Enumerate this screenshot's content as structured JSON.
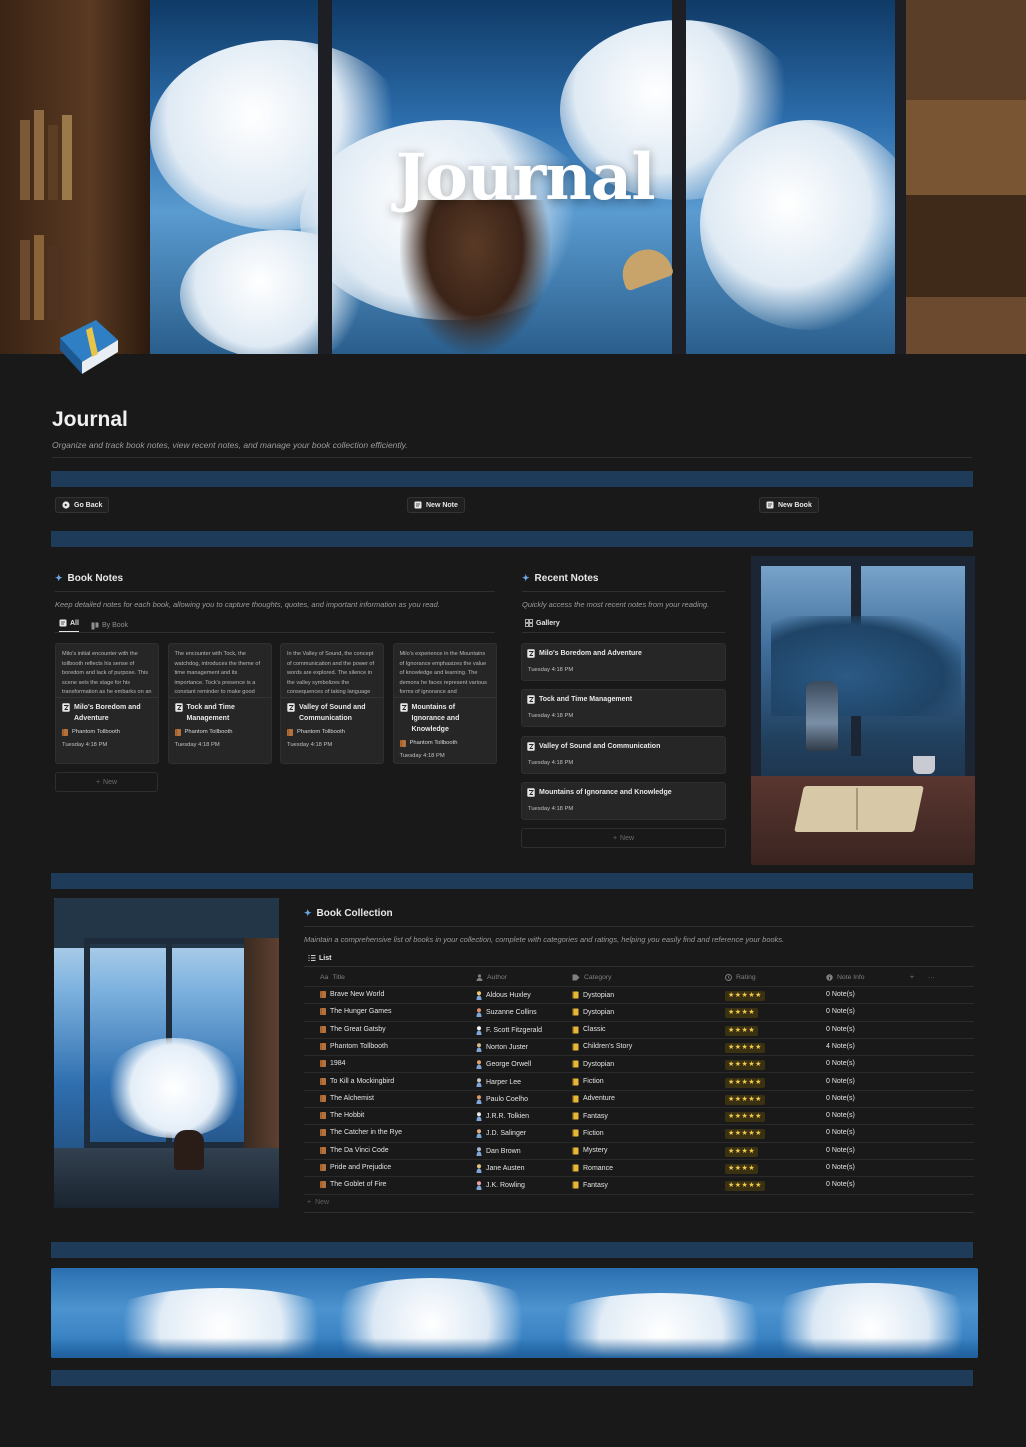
{
  "cover": {
    "title": "Journal"
  },
  "page": {
    "title": "Journal",
    "description": "Organize and track book notes, view recent notes, and manage your book collection efficiently."
  },
  "actions": {
    "go_back": "Go Back",
    "new_note": "New Note",
    "new_book": "New Book"
  },
  "book_notes": {
    "heading": "Book Notes",
    "description": "Keep detailed notes for each book, allowing you to capture thoughts, quotes, and important information as you read.",
    "tabs": [
      {
        "label": "All",
        "active": true
      },
      {
        "label": "By Book",
        "active": false
      }
    ],
    "new_label": "New",
    "cards": [
      {
        "preview": "Milo's initial encounter with the tollbooth reflects his sense of boredom and lack of purpose. This scene sets the stage for his transformation as he embarks on an unexpected adventure.",
        "title": "Milo's Boredom and Adventure",
        "book": "Phantom Tollbooth",
        "date": "Tuesday 4:18 PM"
      },
      {
        "preview": "The encounter with Tock, the watchdog, introduces the theme of time management and its importance. Tock's presence is a constant reminder to make good use of time, contrasting with",
        "title": "Tock and Time Management",
        "book": "Phantom Tollbooth",
        "date": "Tuesday 4:18 PM"
      },
      {
        "preview": "In the Valley of Sound, the concept of communication and the power of words are explored. The silence in the valley symbolizes the consequences of taking language and sound for",
        "title": "Valley of Sound and Communication",
        "book": "Phantom Tollbooth",
        "date": "Tuesday 4:18 PM"
      },
      {
        "preview": "Milo's experience in the Mountains of Ignorance emphasizes the value of knowledge and learning. The demons he faces represent various forms of ignorance and",
        "title": "Mountains of Ignorance and Knowledge",
        "book": "Phantom Tollbooth",
        "date": "Tuesday 4:18 PM"
      }
    ]
  },
  "recent_notes": {
    "heading": "Recent Notes",
    "description": "Quickly access the most recent notes from your reading.",
    "view_label": "Gallery",
    "new_label": "New",
    "items": [
      {
        "title": "Milo's Boredom and Adventure",
        "date": "Tuesday 4:18 PM"
      },
      {
        "title": "Tock and Time Management",
        "date": "Tuesday 4:18 PM"
      },
      {
        "title": "Valley of Sound and Communication",
        "date": "Tuesday 4:18 PM"
      },
      {
        "title": "Mountains of Ignorance and Knowledge",
        "date": "Tuesday 4:18 PM"
      }
    ]
  },
  "book_collection": {
    "heading": "Book Collection",
    "description": "Maintain a comprehensive list of books in your collection, complete with categories and ratings, helping you easily find and reference your books.",
    "view_label": "List",
    "new_label": "New",
    "columns": {
      "title": "Title",
      "author": "Author",
      "category": "Category",
      "rating": "Rating",
      "note_info": "Note Info",
      "title_prefix": "Aa",
      "add": "+",
      "more": "···"
    },
    "rows": [
      {
        "title": "Brave New World",
        "author": "Aldous Huxley",
        "category": "Dystopian",
        "rating": 5,
        "note_info": "0 Note(s)"
      },
      {
        "title": "The Hunger Games",
        "author": "Suzanne Collins",
        "category": "Dystopian",
        "rating": 4,
        "note_info": "0 Note(s)"
      },
      {
        "title": "The Great Gatsby",
        "author": "F. Scott Fitzgerald",
        "category": "Classic",
        "rating": 4,
        "note_info": "0 Note(s)"
      },
      {
        "title": "Phantom Tollbooth",
        "author": "Norton Juster",
        "category": "Children's Story",
        "rating": 5,
        "note_info": "4 Note(s)"
      },
      {
        "title": "1984",
        "author": "George Orwell",
        "category": "Dystopian",
        "rating": 5,
        "note_info": "0 Note(s)"
      },
      {
        "title": "To Kill a Mockingbird",
        "author": "Harper Lee",
        "category": "Fiction",
        "rating": 5,
        "note_info": "0 Note(s)"
      },
      {
        "title": "The Alchemist",
        "author": "Paulo Coelho",
        "category": "Adventure",
        "rating": 5,
        "note_info": "0 Note(s)"
      },
      {
        "title": "The Hobbit",
        "author": "J.R.R. Tolkien",
        "category": "Fantasy",
        "rating": 5,
        "note_info": "0 Note(s)"
      },
      {
        "title": "The Catcher in the Rye",
        "author": "J.D. Salinger",
        "category": "Fiction",
        "rating": 5,
        "note_info": "0 Note(s)"
      },
      {
        "title": "The Da Vinci Code",
        "author": "Dan Brown",
        "category": "Mystery",
        "rating": 4,
        "note_info": "0 Note(s)"
      },
      {
        "title": "Pride and Prejudice",
        "author": "Jane Austen",
        "category": "Romance",
        "rating": 4,
        "note_info": "0 Note(s)"
      },
      {
        "title": "The Goblet of Fire",
        "author": "J.K. Rowling",
        "category": "Fantasy",
        "rating": 5,
        "note_info": "0 Note(s)"
      }
    ]
  },
  "colors": {
    "background": "#191919",
    "accent_band": "#1e3c59",
    "star": "#f2c94c",
    "heading_spark": "#6aa7e8"
  }
}
